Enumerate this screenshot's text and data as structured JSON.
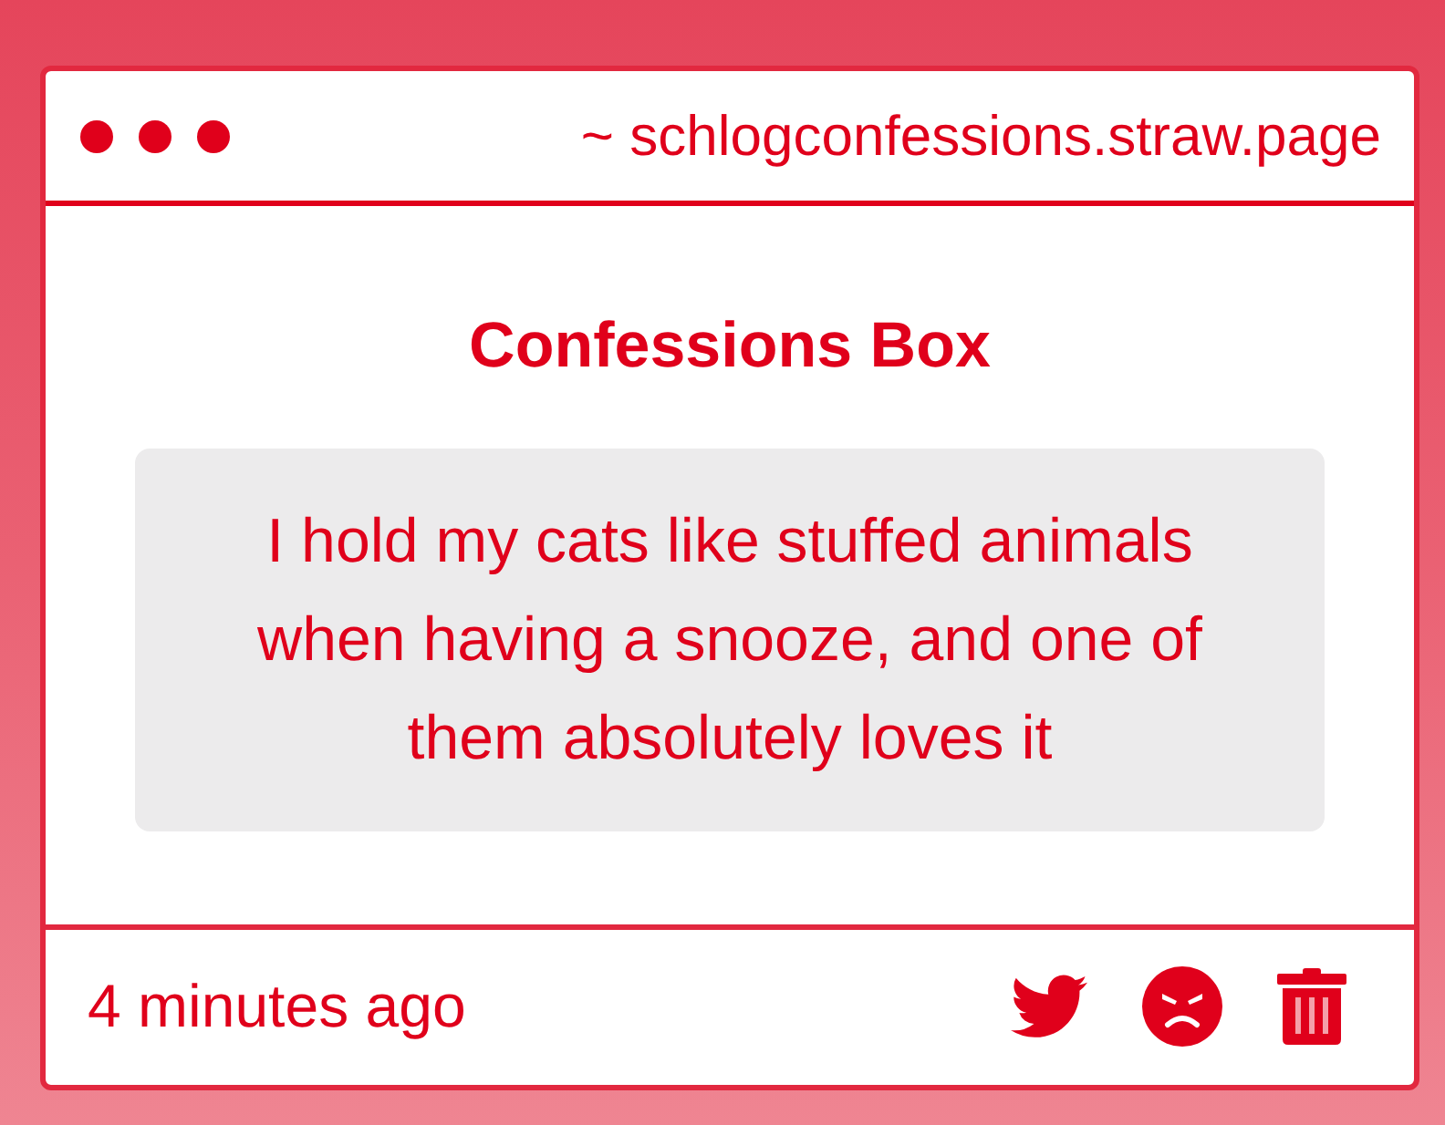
{
  "window": {
    "address": "~ schlogconfessions.straw.page"
  },
  "title": "Confessions Box",
  "confession": "I hold my cats like stuffed animals when having a snooze, and one of them absolutely loves it",
  "footer": {
    "time": "4 minutes ago"
  }
}
